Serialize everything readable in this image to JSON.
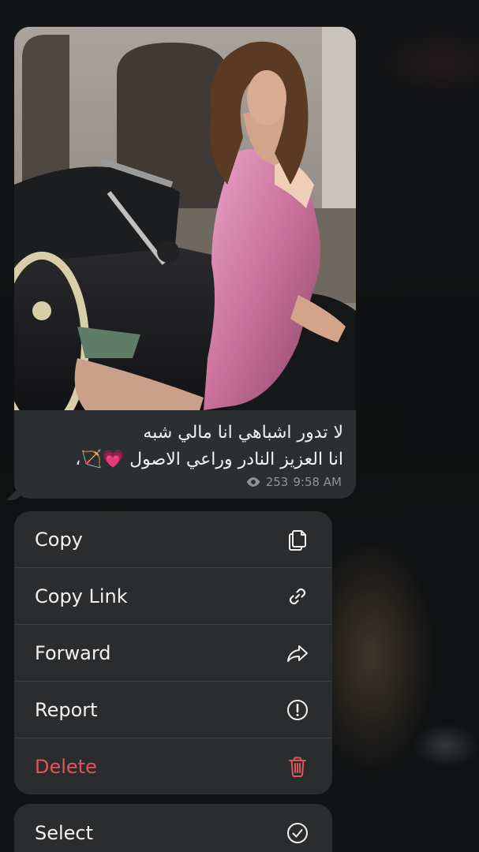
{
  "message": {
    "caption_line1": "لا تدور اشباهي انا مالي شبه",
    "caption_line2": "انا العزيز النادر وراعي الاصول 💗🏹،",
    "views": "253",
    "time": "9:58 AM"
  },
  "context_menu": {
    "items": [
      {
        "label": "Copy",
        "icon": "copy-icon"
      },
      {
        "label": "Copy Link",
        "icon": "link-icon"
      },
      {
        "label": "Forward",
        "icon": "forward-arrow-icon"
      },
      {
        "label": "Report",
        "icon": "exclamation-circle-icon"
      },
      {
        "label": "Delete",
        "icon": "trash-icon",
        "color": "#e0555a"
      }
    ],
    "secondary": {
      "label": "Select",
      "icon": "check-circle-icon"
    }
  },
  "colors": {
    "bubble": "#2b2f31",
    "menu": "#2a2c2e",
    "danger": "#e0555a"
  }
}
